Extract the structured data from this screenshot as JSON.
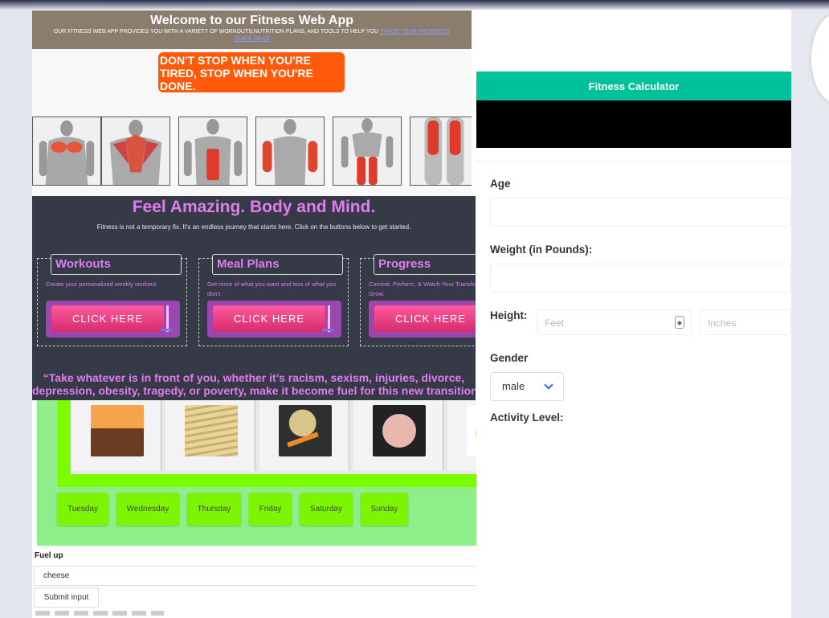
{
  "welcome": {
    "title": "Welcome to our Fitness Web App",
    "subtitle": "OUR FITNESS WEB APP PROVIDES YOU WITH A VARIETY OF WORKOUTS,NUTRITION PLANS, AND TOOLS TO HELP YOU",
    "link_track": "TRACK YOUR PROGRESS",
    "link_quick": "Quick Read",
    "motto": "DON'T STOP WHEN YOU'RE TIRED, STOP WHEN YOU'RE DONE.",
    "muscle_cards": [
      "chest-muscles",
      "back-muscles",
      "abdominal-muscles",
      "arm-muscles",
      "leg-muscles-front",
      "leg-muscles-back"
    ]
  },
  "feel": {
    "title": "Feel Amazing. Body and Mind.",
    "subtitle": "Fitness is not a temporary fix. It's an endless journey that starts here. Click on the buttons below to get started.",
    "cards": [
      {
        "title": "Workouts",
        "text": "Create your personalized weekly workout.",
        "button": "CLICK HERE"
      },
      {
        "title": "Meal Plans",
        "text": "Get more of what you want and less of what you don't.",
        "button": "CLICK HERE"
      },
      {
        "title": "Progress",
        "text": "Commit, Perform, & Watch Your Transformation Grow.",
        "button": "CLICK HERE"
      }
    ],
    "quote_line1": "“Take whatever is in front of you, whether it’s racism, sexism, injuries, divorce,",
    "quote_line2": "depression, obesity, tragedy, or poverty, make it become fuel for this new transition"
  },
  "meals": {
    "images": [
      "orange-cake",
      "french-fries",
      "soup-with-carrots",
      "pasta-salad",
      "pasta-bake"
    ],
    "days": [
      "Tuesday",
      "Wednesday",
      "Thursday",
      "Friday",
      "Saturday",
      "Sunday"
    ]
  },
  "fuel": {
    "label": "Fuel up",
    "input_value": "cheese",
    "submit_label": "Submit input"
  },
  "calculator": {
    "title": "Fitness Calculator",
    "age_label": "Age",
    "weight_label": "Weight (in Pounds):",
    "height_label": "Height:",
    "feet_placeholder": "Feet",
    "inches_placeholder": "Inches",
    "gender_label": "Gender",
    "gender_value": "male",
    "activity_label": "Activity Level:"
  },
  "colors": {
    "header_brown": "#8b7d6b",
    "motto_orange": "#ff5a0a",
    "feel_bg": "#363a46",
    "accent_pink": "#e07cf0",
    "calc_teal": "#00c29a",
    "lime": "#7bfc00",
    "light_green": "#90ee8a"
  }
}
